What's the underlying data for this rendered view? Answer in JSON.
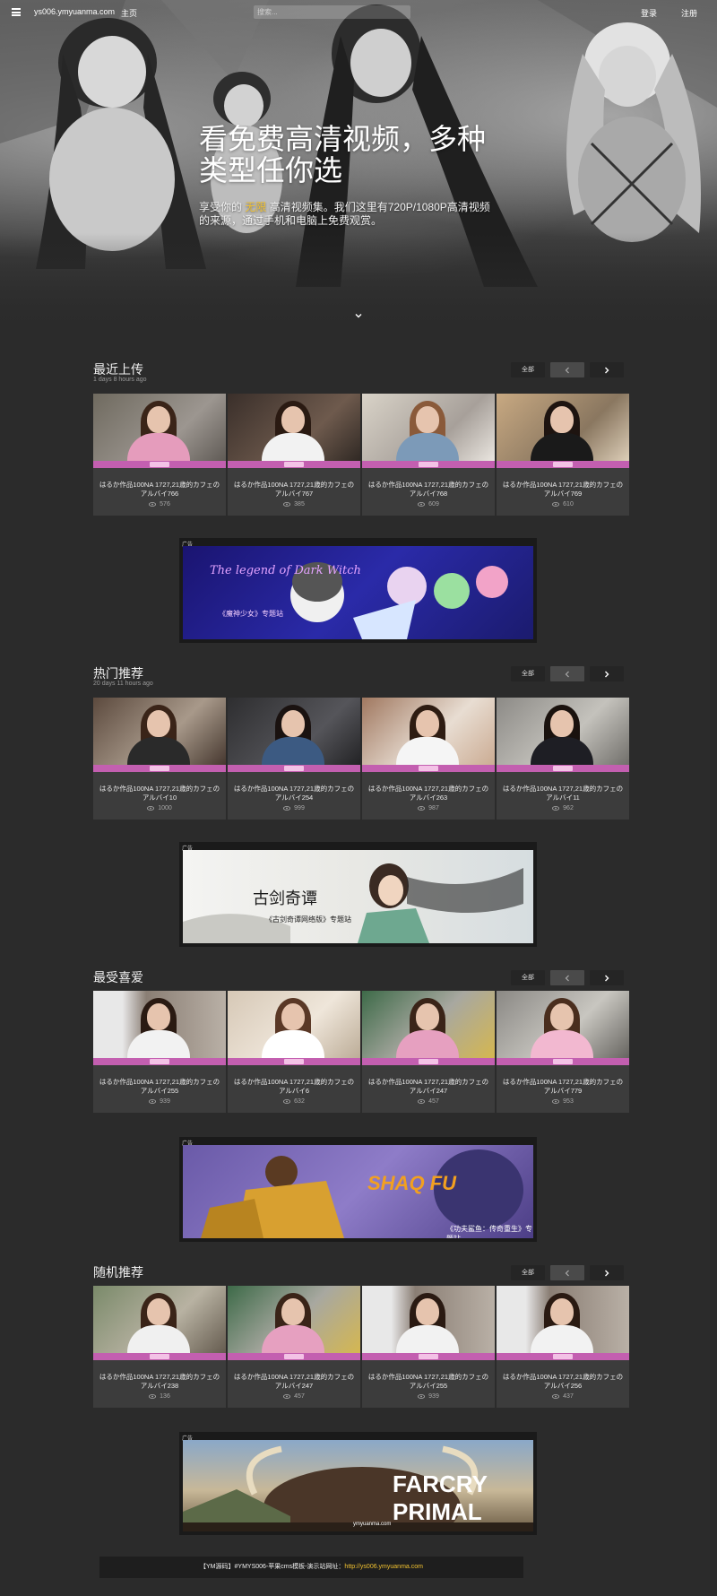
{
  "nav": {
    "site_name": "ys006.ymyuanma.com",
    "home": "主页",
    "search_placeholder": "搜索...",
    "login": "登录",
    "register": "注册"
  },
  "hero": {
    "title": "看免费高清视频，多种类型任你选",
    "desc_prefix": "享受你的",
    "desc_highlight": "无限",
    "desc_suffix": "高清视频集。我们这里有720P/1080P高清视频的来源，通过手机和电脑上免费观赏。"
  },
  "sections": [
    {
      "title": "最近上传",
      "subtitle": "1 days 8 hours ago",
      "all_label": "全部",
      "cards": [
        {
          "title": "はるか作品100NA 1727,21歳的カフェのアルバイ766",
          "views": "576"
        },
        {
          "title": "はるか作品100NA 1727,21歳的カフェのアルバイ767",
          "views": "385"
        },
        {
          "title": "はるか作品100NA 1727,21歳的カフェのアルバイ768",
          "views": "609"
        },
        {
          "title": "はるか作品100NA 1727,21歳的カフェのアルバイ769",
          "views": "610"
        }
      ]
    },
    {
      "title": "热门推荐",
      "subtitle": "20 days 11 hours ago",
      "all_label": "全部",
      "cards": [
        {
          "title": "はるか作品100NA 1727,21歳的カフェのアルバイ10",
          "views": "1000"
        },
        {
          "title": "はるか作品100NA 1727,21歳的カフェのアルバイ254",
          "views": "999"
        },
        {
          "title": "はるか作品100NA 1727,21歳的カフェのアルバイ263",
          "views": "987"
        },
        {
          "title": "はるか作品100NA 1727,21歳的カフェのアルバイ11",
          "views": "962"
        }
      ]
    },
    {
      "title": "最受喜爱",
      "subtitle": "",
      "all_label": "全部",
      "cards": [
        {
          "title": "はるか作品100NA 1727,21歳的カフェのアルバイ255",
          "views": "939"
        },
        {
          "title": "はるか作品100NA 1727,21歳的カフェのアルバイ6",
          "views": "632"
        },
        {
          "title": "はるか作品100NA 1727,21歳的カフェのアルバイ247",
          "views": "457"
        },
        {
          "title": "はるか作品100NA 1727,21歳的カフェのアルバイ779",
          "views": "953"
        }
      ]
    },
    {
      "title": "随机推荐",
      "subtitle": "",
      "all_label": "全部",
      "cards": [
        {
          "title": "はるか作品100NA 1727,21歳的カフェのアルバイ238",
          "views": "136"
        },
        {
          "title": "はるか作品100NA 1727,21歳的カフェのアルバイ247",
          "views": "457"
        },
        {
          "title": "はるか作品100NA 1727,21歳的カフェのアルバイ255",
          "views": "939"
        },
        {
          "title": "はるか作品100NA 1727,21歳的カフェのアルバイ256",
          "views": "437"
        }
      ]
    }
  ],
  "ads": [
    {
      "label": "广告",
      "logo": "The legend of Dark Witch",
      "caption": "《魔神少女》专题站"
    },
    {
      "label": "广告",
      "logo": "古剑奇谭",
      "caption": "《古剑奇谭网络版》专题站"
    },
    {
      "label": "广告",
      "logo": "SHAQ FU",
      "caption": "《功夫鲨鱼：传奇重生》专题站"
    },
    {
      "label": "广告",
      "logo": "FARCRY PRIMAL",
      "caption": "ymyuanma.com"
    }
  ],
  "footer": {
    "text": "【YM源码】#YMYS006-苹果cms模板-演示站网址：",
    "link": "http://ys006.ymyuanma.com"
  },
  "colors": {
    "background": "#2b2b2b",
    "card": "#3c3c3c",
    "accent_bar": "#c35fb0",
    "highlight": "#f2c230"
  }
}
